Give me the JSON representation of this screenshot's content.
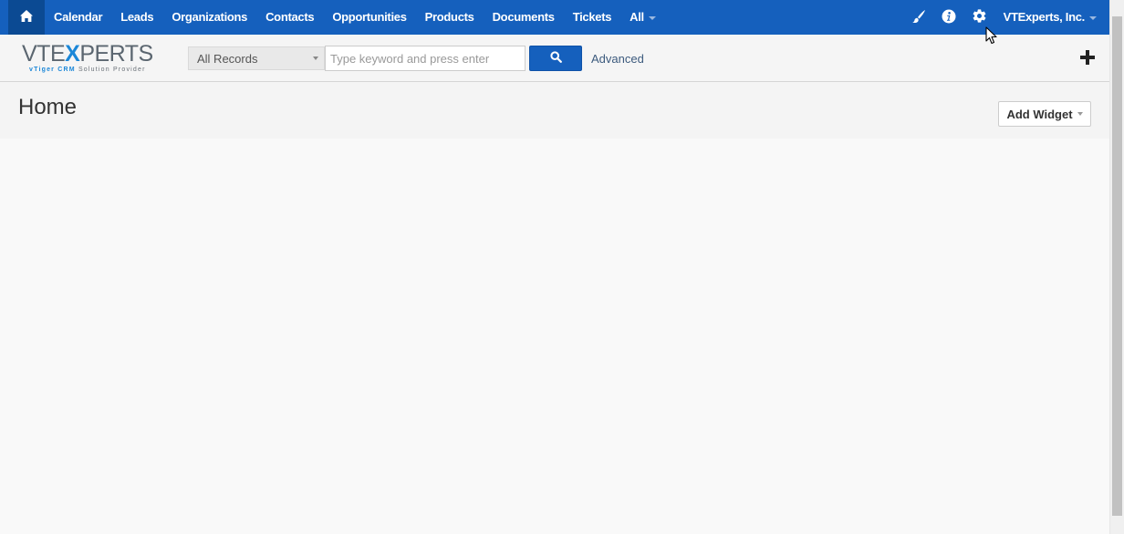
{
  "topnav": {
    "home_icon": "home-icon",
    "items": [
      {
        "label": "Calendar"
      },
      {
        "label": "Leads"
      },
      {
        "label": "Organizations"
      },
      {
        "label": "Contacts"
      },
      {
        "label": "Opportunities"
      },
      {
        "label": "Products"
      },
      {
        "label": "Documents"
      },
      {
        "label": "Tickets"
      },
      {
        "label": "All"
      }
    ],
    "right_icons": [
      "paintbrush-icon",
      "info-icon",
      "gear-icon"
    ],
    "user_label": "VTExperts, Inc."
  },
  "logo": {
    "main_prefix": "VTE",
    "main_x": "X",
    "main_suffix": "PERTS",
    "sub_highlight": "vTiger CRM",
    "sub_rest": "Solution Provider"
  },
  "search": {
    "record_type": "All Records",
    "placeholder": "Type keyword and press enter",
    "value": "",
    "button_icon": "search-icon",
    "advanced_label": "Advanced"
  },
  "page": {
    "title": "Home",
    "add_widget_label": "Add Widget"
  },
  "colors": {
    "nav_bg": "#1560bd",
    "home_bg": "#0b4a93",
    "accent": "#1b87d8"
  }
}
